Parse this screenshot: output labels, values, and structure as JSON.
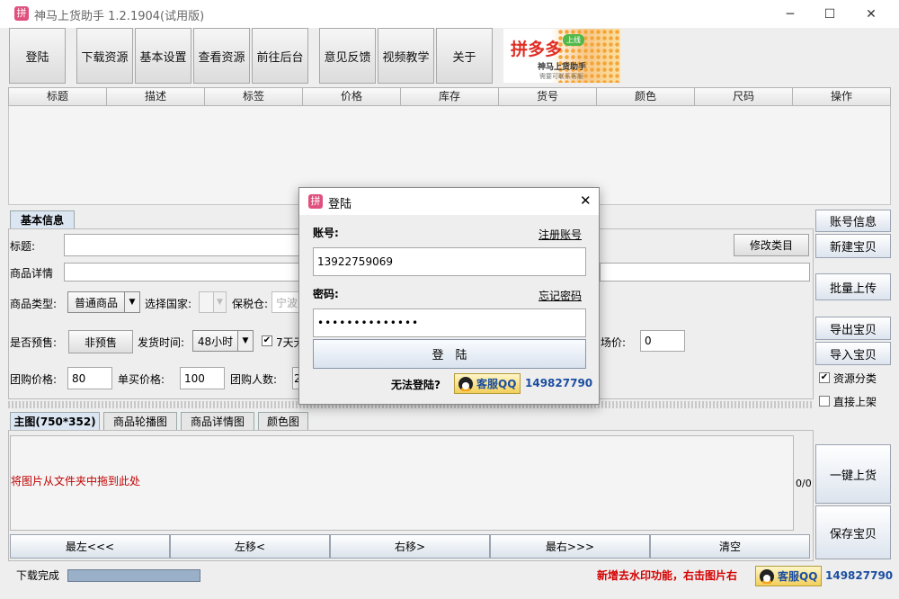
{
  "window": {
    "title": "神马上货助手 1.2.1904(试用版)",
    "icon_glyph": "拼",
    "minimize_glyph": "─",
    "maximize_glyph": "☐",
    "close_glyph": "✕"
  },
  "toolbar": {
    "buttons": [
      "登陆",
      "下载资源",
      "基本设置",
      "查看资源",
      "前往后台",
      "意见反馈",
      "视频教学",
      "关于"
    ]
  },
  "logo": {
    "brand": "拼多多",
    "badge": "上线",
    "line1": "神马上货助手",
    "line2": "需要可联系客服"
  },
  "table": {
    "columns": [
      "标题",
      "描述",
      "标签",
      "价格",
      "库存",
      "货号",
      "颜色",
      "尺码",
      "操作"
    ]
  },
  "basic_info": {
    "tab_label": "基本信息",
    "title_label": "标题:",
    "title_value": "",
    "detail_label": "商品详情",
    "detail_value": "",
    "modify_category": "修改类目",
    "product_type_label": "商品类型:",
    "product_type_value": "普通商品",
    "country_label": "选择国家:",
    "country_value": "",
    "bonded_label": "保税仓:",
    "bonded_value": "宁波",
    "presale_label": "是否预售:",
    "presale_button": "非预售",
    "ship_time_label": "发货时间:",
    "ship_time_value": "48小时",
    "seven_days_label": "7天无",
    "seven_days_checked": true,
    "market_price_label": "场价:",
    "market_price_value": "0",
    "group_price_label": "团购价格:",
    "group_price_value": "80",
    "single_price_label": "单买价格:",
    "single_price_value": "100",
    "group_count_label": "团购人数:",
    "group_count_value": "2"
  },
  "right_panel": {
    "account_info": "账号信息",
    "new_item": "新建宝贝",
    "batch_upload": "批量上传",
    "export_items": "导出宝贝",
    "import_items": "导入宝贝",
    "resource_category_label": "资源分类",
    "resource_category_checked": true,
    "direct_listing_label": "直接上架",
    "direct_listing_checked": false,
    "one_click": "一键上货",
    "save_item": "保存宝贝"
  },
  "image_tabs": [
    "主图(750*352)",
    "商品轮播图",
    "商品详情图",
    "颜色图"
  ],
  "image_area": {
    "hint": "将图片从文件夹中拖到此处",
    "counter": "0/0"
  },
  "image_nav": [
    "最左<<<",
    "左移<",
    "右移>",
    "最右>>>",
    "清空"
  ],
  "status": {
    "text": "下载完成",
    "progress": 1.0,
    "notice": "新增去水印功能，右击图片右",
    "qq_label": "客服QQ",
    "qq_number": "149827790"
  },
  "login_dialog": {
    "title": "登陆",
    "close_glyph": "✕",
    "account_label": "账号:",
    "register_link": "注册账号",
    "account_value": "13922759069",
    "password_label": "密码:",
    "forgot_link": "忘记密码",
    "password_value": "••••••••••••••",
    "login_button": "登　陆",
    "cannot_login": "无法登陆?",
    "qq_label": "客服QQ",
    "qq_number": "149827790"
  },
  "colors": {
    "notice_red": "#d40000",
    "qq_blue": "#1b4ea0",
    "hint_red": "#c00000"
  }
}
